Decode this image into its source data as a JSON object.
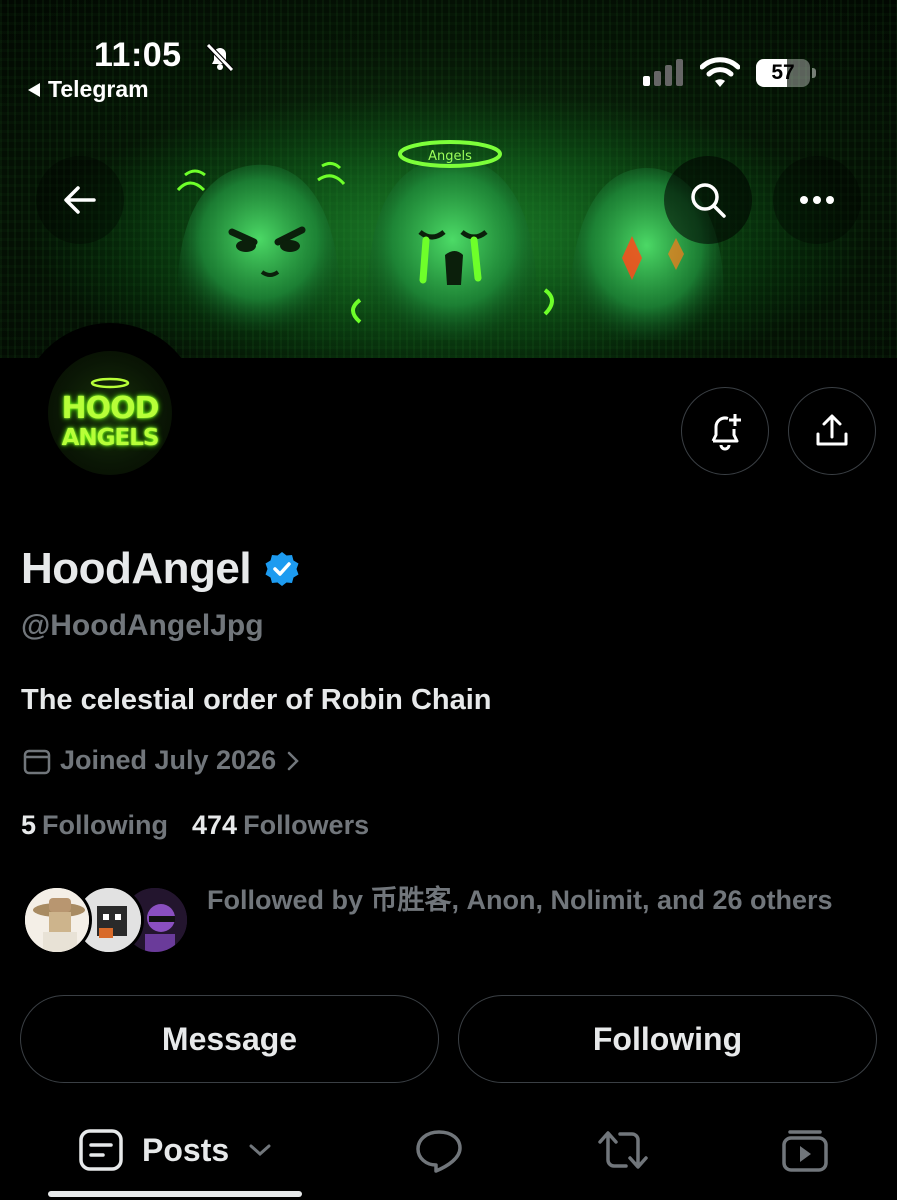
{
  "status_bar": {
    "time": "11:05",
    "back_app": "Telegram",
    "battery": "57",
    "battery_level": 0.57
  },
  "profile": {
    "display_name": "HoodAngel",
    "handle": "@HoodAngelJpg",
    "bio": "The celestial order of Robin Chain",
    "joined": "Joined July 2026",
    "following_count": "5",
    "following_label": "Following",
    "followers_count": "474",
    "followers_label": "Followers",
    "followed_by": "Followed by 币胜客, Anon, Nolimit, and 26 others",
    "avatar_line1": "HOOD",
    "avatar_line2": "ANGELS",
    "banner_halo_text": "Angels",
    "verified": true
  },
  "actions": {
    "message": "Message",
    "following": "Following"
  },
  "tabs": {
    "posts": "Posts"
  },
  "colors": {
    "background": "#000000",
    "text_primary": "#e7e9ea",
    "text_secondary": "#71767b",
    "verified_blue": "#1d9bf0",
    "border": "#3a3f44",
    "neon_green": "#7dff3a"
  },
  "icons": [
    "bell-off-icon",
    "signal-icon",
    "wifi-icon",
    "back-arrow-icon",
    "search-icon",
    "more-icon",
    "notification-add-icon",
    "share-icon",
    "verified-badge-icon",
    "calendar-icon",
    "chevron-right-icon",
    "posts-icon",
    "chevron-down-icon",
    "replies-icon",
    "repost-icon",
    "video-icon"
  ]
}
